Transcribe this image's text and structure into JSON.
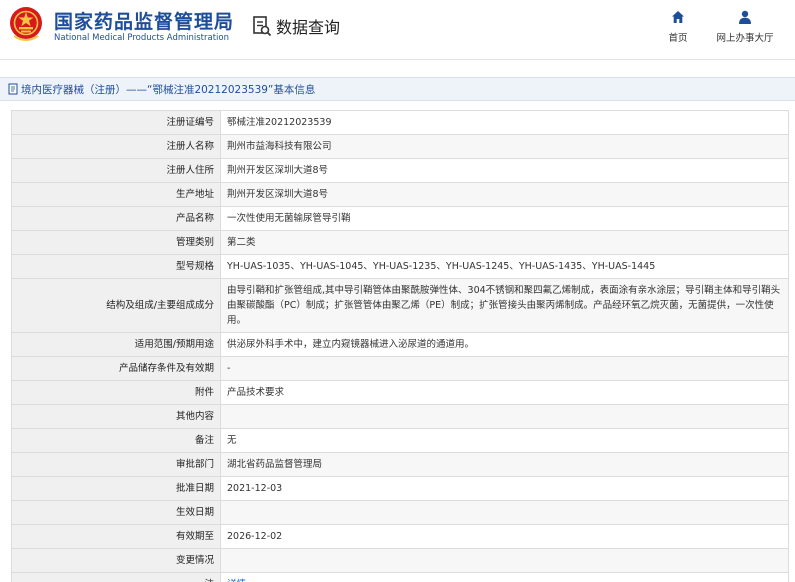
{
  "header": {
    "brand_cn": "国家药品监督管理局",
    "brand_en": "National Medical Products Administration",
    "query_label": "数据查询",
    "nav": {
      "home": "首页",
      "hall": "网上办事大厅"
    },
    "brand_color": "#1f4e99",
    "emblem_color": "#d7191c"
  },
  "title_bar": {
    "text": "境内医疗器械（注册）——“鄂械注准20212023539”基本信息"
  },
  "fields": [
    {
      "label": "注册证编号",
      "value": "鄂械注准20212023539"
    },
    {
      "label": "注册人名称",
      "value": "荆州市益海科技有限公司"
    },
    {
      "label": "注册人住所",
      "value": "荆州开发区深圳大道8号"
    },
    {
      "label": "生产地址",
      "value": "荆州开发区深圳大道8号"
    },
    {
      "label": "产品名称",
      "value": "一次性使用无菌输尿管导引鞘"
    },
    {
      "label": "管理类别",
      "value": "第二类"
    },
    {
      "label": "型号规格",
      "value": "YH-UAS-1035、YH-UAS-1045、YH-UAS-1235、YH-UAS-1245、YH-UAS-1435、YH-UAS-1445"
    },
    {
      "label": "结构及组成/主要组成成分",
      "value": "由导引鞘和扩张管组成,其中导引鞘管体由聚酰胺弹性体、304不锈钢和聚四氟乙烯制成，表面涂有亲水涂层；导引鞘主体和导引鞘头由聚碳酸酯（PC）制成；扩张管管体由聚乙烯（PE）制成；扩张管接头由聚丙烯制成。产品经环氧乙烷灭菌，无菌提供，一次性使用。"
    },
    {
      "label": "适用范围/预期用途",
      "value": "供泌尿外科手术中，建立内窥镜器械进入泌尿道的通道用。"
    },
    {
      "label": "产品储存条件及有效期",
      "value": "-"
    },
    {
      "label": "附件",
      "value": "产品技术要求"
    },
    {
      "label": "其他内容",
      "value": ""
    },
    {
      "label": "备注",
      "value": "无"
    },
    {
      "label": "审批部门",
      "value": "湖北省药品监督管理局"
    },
    {
      "label": "批准日期",
      "value": "2021-12-03"
    },
    {
      "label": "生效日期",
      "value": ""
    },
    {
      "label": "有效期至",
      "value": "2026-12-02"
    },
    {
      "label": "变更情况",
      "value": ""
    }
  ],
  "note": {
    "label": "注",
    "link": "详情"
  }
}
